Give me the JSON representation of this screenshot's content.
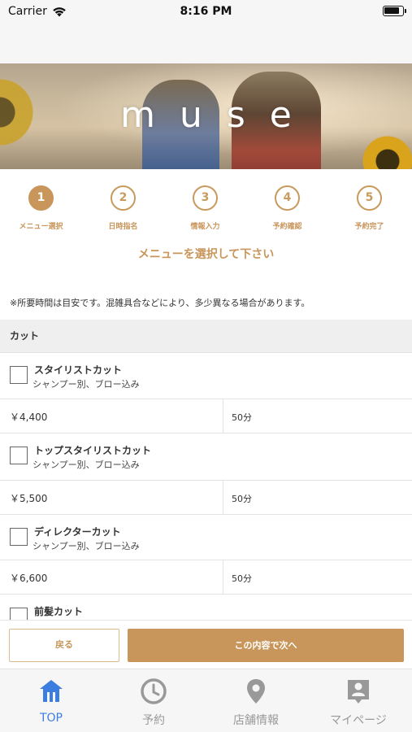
{
  "status_bar": {
    "carrier": "Carrier",
    "time": "8:16 PM"
  },
  "hero": {
    "logo": "muse"
  },
  "steps": [
    {
      "number": "1",
      "label": "メニュー選択",
      "active": true
    },
    {
      "number": "2",
      "label": "日時指名",
      "active": false
    },
    {
      "number": "3",
      "label": "情報入力",
      "active": false
    },
    {
      "number": "4",
      "label": "予約確認",
      "active": false
    },
    {
      "number": "5",
      "label": "予約完了",
      "active": false
    }
  ],
  "section_title": "メニューを選択して下さい",
  "notice": "※所要時間は目安です。混雑具合などにより、多少異なる場合があります。",
  "category": "カット",
  "menu_items": [
    {
      "name": "スタイリストカット",
      "description": "シャンプー別、ブロー込み",
      "price": "￥4,400",
      "duration": "50分",
      "checked": false
    },
    {
      "name": "トップスタイリストカット",
      "description": "シャンプー別、ブロー込み",
      "price": "￥5,500",
      "duration": "50分",
      "checked": false
    },
    {
      "name": "ディレクターカット",
      "description": "シャンプー別、ブロー込み",
      "price": "￥6,600",
      "duration": "50分",
      "checked": false
    },
    {
      "name": "前髪カット",
      "checked": false
    }
  ],
  "actions": {
    "back_label": "戻る",
    "next_label": "この内容で次へ"
  },
  "tab_bar": [
    {
      "label": "TOP",
      "icon": "home-icon",
      "active": true
    },
    {
      "label": "予約",
      "icon": "clock-icon",
      "active": false
    },
    {
      "label": "店舗情報",
      "icon": "map-pin-icon",
      "active": false
    },
    {
      "label": "マイページ",
      "icon": "person-badge-icon",
      "active": false
    }
  ],
  "colors": {
    "accent": "#c8955a",
    "tab_active": "#3b7ee0",
    "tab_inactive": "#999999"
  }
}
